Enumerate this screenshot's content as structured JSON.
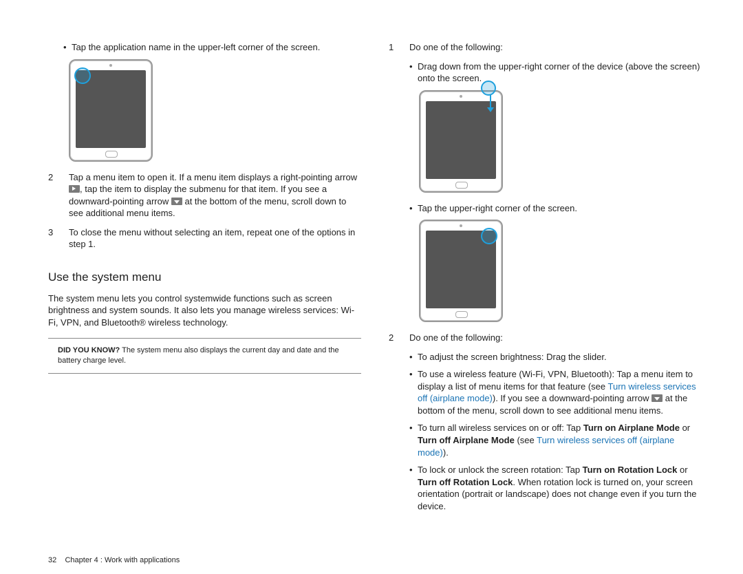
{
  "left": {
    "b1": "Tap the application name in the upper-left corner of the screen.",
    "n2": "2",
    "t2a": "Tap a menu item to open it. If a menu item displays a right-pointing arrow ",
    "t2b": ", tap the item to display the submenu for that item. If you see a downward-pointing arrow ",
    "t2c": " at the bottom of the menu, scroll down to see additional menu items.",
    "n3": "3",
    "t3": "To close the menu without selecting an item, repeat one of the options in step 1.",
    "section": "Use the system menu",
    "para": "The system menu lets you control systemwide functions such as screen brightness and system sounds. It also lets you manage wireless services: Wi-Fi, VPN, and Bluetooth® wireless technology.",
    "dyk_label": "DID YOU KNOW?",
    "dyk_text": " The system menu also displays the current day and date and the battery charge level."
  },
  "right": {
    "n1": "1",
    "t1": "Do one of the following:",
    "b1a": "Drag down from the upper-right corner of the device (above the screen) onto the screen.",
    "b1b": "Tap the upper-right corner of the screen.",
    "n2": "2",
    "t2": "Do one of the following:",
    "b2a": "To adjust the screen brightness: Drag the slider.",
    "b2b_a": "To use a wireless feature (Wi-Fi, VPN, Bluetooth): Tap a menu item to display a list of menu items for that feature (see ",
    "b2b_link": "Turn wireless services off (airplane mode)",
    "b2b_b": "). If you see a downward-pointing arrow ",
    "b2b_c": " at the bottom of the menu, scroll down to see additional menu items.",
    "b2c_a": "To turn all wireless services on or off: Tap ",
    "b2c_s1": "Turn on Airplane Mode",
    "b2c_b": " or ",
    "b2c_s2": "Turn off Airplane Mode",
    "b2c_c": " (see ",
    "b2c_link": "Turn wireless services off (airplane mode)",
    "b2c_d": ").",
    "b2d_a": "To lock or unlock the screen rotation: Tap ",
    "b2d_s1": "Turn on Rotation Lock",
    "b2d_b": " or ",
    "b2d_s2": "Turn off Rotation Lock",
    "b2d_c": ". When rotation lock is turned on, your screen orientation (portrait or landscape) does not change even if you turn the device."
  },
  "footer": {
    "page": "32",
    "chapter": "Chapter 4 : Work with applications"
  }
}
